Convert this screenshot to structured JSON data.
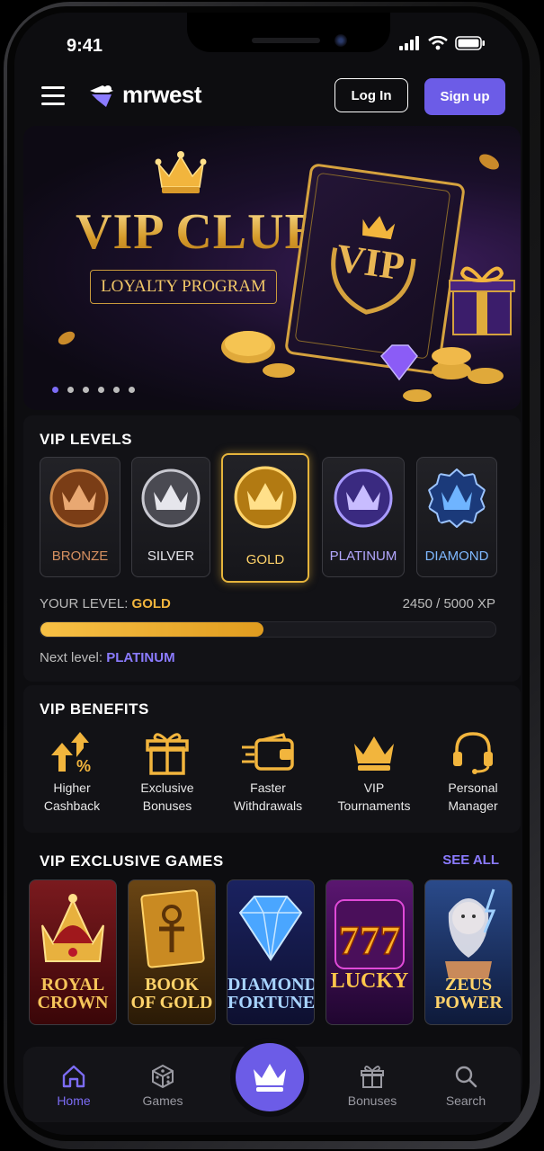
{
  "status": {
    "time": "9:41"
  },
  "header": {
    "logo": "mrwest",
    "login_label": "Log In",
    "signup_label": "Sign up"
  },
  "banner": {
    "title": "VIP CLUB",
    "subtitle": "LOYALTY PROGRAM",
    "card_text": "VIP",
    "slides": 6,
    "active_slide": 0
  },
  "vip_levels": {
    "title": "VIP LEVELS",
    "levels": [
      {
        "name": "BRONZE",
        "color": "#c97a3c"
      },
      {
        "name": "SILVER",
        "color": "#b8b8c0"
      },
      {
        "name": "GOLD",
        "color": "#f2b53d",
        "selected": true
      },
      {
        "name": "PLATINUM",
        "color": "#8e7bff"
      },
      {
        "name": "DIAMOND",
        "color": "#5aa6ff"
      }
    ],
    "your_level_label": "YOUR LEVEL:",
    "your_level_value": "GOLD",
    "xp_text": "2450 / 5000 XP",
    "progress_fraction": 0.49,
    "next_level_label": "Next level:",
    "next_level_value": "PLATINUM"
  },
  "vip_benefits": {
    "title": "VIP BENEFITS",
    "items": [
      {
        "label": "Higher\nCashback",
        "icon": "cashback-up-icon"
      },
      {
        "label": "Exclusive\nBonuses",
        "icon": "gift-icon"
      },
      {
        "label": "Faster\nWithdrawals",
        "icon": "fast-wallet-icon"
      },
      {
        "label": "VIP\nTournaments",
        "icon": "crown-icon"
      },
      {
        "label": "Personal\nManager",
        "icon": "headset-icon"
      }
    ]
  },
  "vip_games": {
    "title": "VIP EXCLUSIVE GAMES",
    "see_all": "SEE ALL",
    "games": [
      {
        "title": "ROYAL\nCROWN",
        "bg": "#5a0f14"
      },
      {
        "title": "BOOK\nOF GOLD",
        "bg": "#3f2a0c"
      },
      {
        "title": "DIAMOND\nFORTUNE",
        "bg": "#151a3f"
      },
      {
        "title": "LUCKY",
        "bg": "#3a0f4a"
      },
      {
        "title": "ZEUS\nPOWER",
        "bg": "#15264d"
      }
    ]
  },
  "nav": {
    "items": [
      {
        "label": "Home",
        "icon": "home-icon",
        "active": true
      },
      {
        "label": "Games",
        "icon": "dice-icon"
      },
      {
        "label": "Bonuses",
        "icon": "gift-icon"
      },
      {
        "label": "Search",
        "icon": "search-icon"
      }
    ],
    "center_icon": "crown-icon"
  },
  "colors": {
    "accent": "#6c5ce7",
    "gold": "#f2b53d",
    "background": "#0d0d10"
  }
}
